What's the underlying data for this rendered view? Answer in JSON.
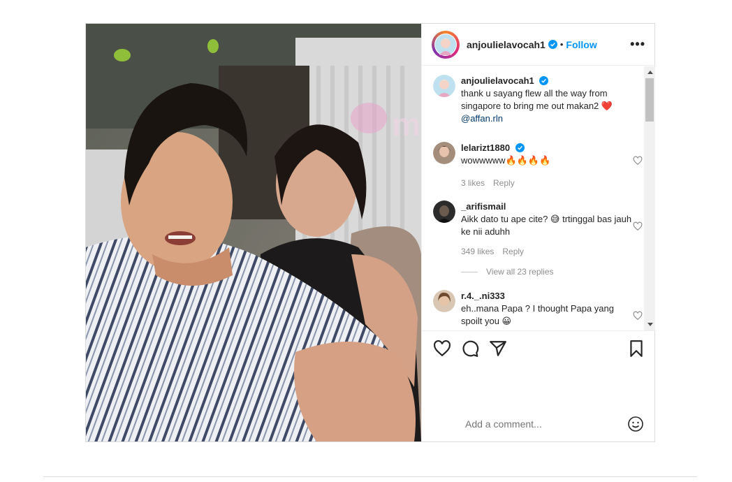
{
  "post": {
    "username": "anjoulielavocah1",
    "follow_label": "Follow",
    "more_icon": "more-options-icon",
    "caption": "thank u sayang flew all the way from singapore to bring me out makan2 ❤️",
    "caption_mention": "@affan.rln",
    "watermark": "murai"
  },
  "comments": [
    {
      "user": "lelarizt1880",
      "text": "wowwwww🔥🔥🔥🔥",
      "likes": "3 likes",
      "reply": "Reply"
    },
    {
      "user": "_arifismail",
      "text": "Aikk dato tu ape cite? 😅 trtinggal bas jauh ke nii aduhh",
      "likes": "349 likes",
      "reply": "Reply"
    },
    {
      "user": "r.4._.ni333",
      "text": "eh..mana Papa ? I thought Papa yang spoilt you 😀"
    }
  ],
  "view_replies": "View all 23 replies",
  "actions": {
    "like": "heart-icon",
    "comment": "comment-icon",
    "share": "share-icon",
    "save": "bookmark-icon"
  },
  "add_comment": {
    "placeholder": "Add a comment...",
    "emoji_icon": "emoji-icon"
  },
  "colors": {
    "link": "#0095f6",
    "text": "#262626",
    "muted": "#8e8e8e",
    "verified": "#0095f6",
    "heart": "#ed4956"
  }
}
